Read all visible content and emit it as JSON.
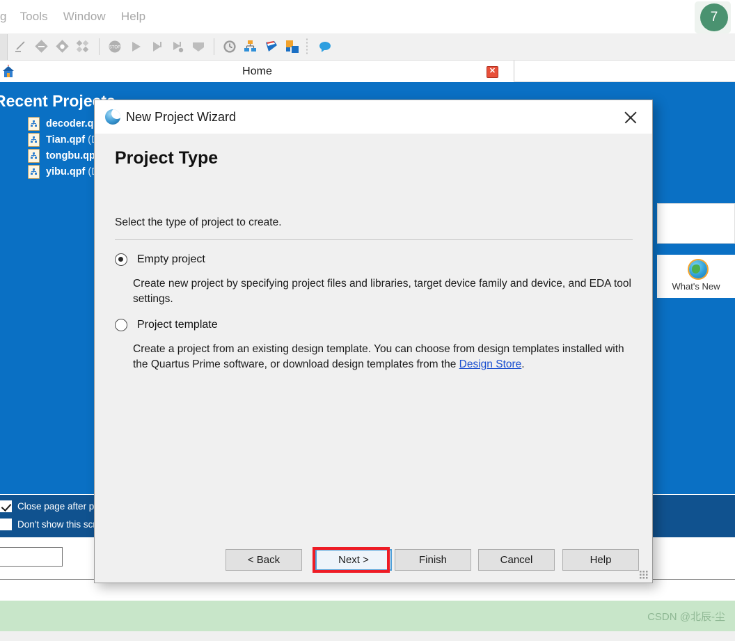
{
  "menubar": {
    "items": [
      {
        "label": "g",
        "clipped": true
      },
      {
        "label": "Tools"
      },
      {
        "label": "Window"
      },
      {
        "label": "Help"
      }
    ],
    "notification_count": "7",
    "notification_color": "#4a9270"
  },
  "toolbar": {
    "icons": [
      "pencil-line-icon",
      "diamond-minus-icon",
      "diamond-clock-icon",
      "diamond-scatter-icon",
      "stop-sign-icon",
      "play-icon",
      "play-flag-icon",
      "play-flag-cancel-icon",
      "pentagon-down-icon",
      "clock-icon",
      "hierarchy-icon",
      "ribbon-icon",
      "puzzle-icon",
      "speech-bubble-icon"
    ]
  },
  "tabbar": {
    "home_tab_label": "Home",
    "home_tab_icon": "house-icon",
    "close_icon": "close-tab-icon"
  },
  "home": {
    "recent_projects_title": "Recent Projects",
    "recent_projects": [
      {
        "name": "decoder.qpf",
        "path": ""
      },
      {
        "name": "Tian.qpf",
        "path": "(D:"
      },
      {
        "name": "tongbu.qpf",
        "path": ""
      },
      {
        "name": "yibu.qpf",
        "path": "(D:"
      }
    ],
    "whats_new": {
      "label": "What's New",
      "icon": "globe-refresh-icon"
    },
    "footer_checkboxes": [
      {
        "label": "Close page after pr",
        "checked": true
      },
      {
        "label": "Don't show this scr",
        "checked": false
      }
    ],
    "background_color": "#0a70c4",
    "footer_color": "#10528f"
  },
  "dialog": {
    "title": "New Project Wizard",
    "app_icon": "quartus-globe-icon",
    "close_icon": "close-icon",
    "heading": "Project Type",
    "subtitle": "Select the type of project to create.",
    "options": [
      {
        "label": "Empty project",
        "selected": true,
        "description": "Create new project by specifying project files and libraries, target device family and device, and EDA tool settings."
      },
      {
        "label": "Project template",
        "selected": false,
        "description_before_link": "Create a project from an existing design template. You can choose from design templates installed with the Quartus Prime software, or download design templates from the ",
        "link_text": "Design Store",
        "description_after_link": "."
      }
    ],
    "buttons": {
      "back": "< Back",
      "next": "Next >",
      "finish": "Finish",
      "cancel": "Cancel",
      "help": "Help"
    },
    "highlighted_button": "Next >",
    "highlight_color": "#ee1c25"
  },
  "watermark": {
    "text": "CSDN @北辰-尘",
    "band_color": "#c8e6c9"
  }
}
